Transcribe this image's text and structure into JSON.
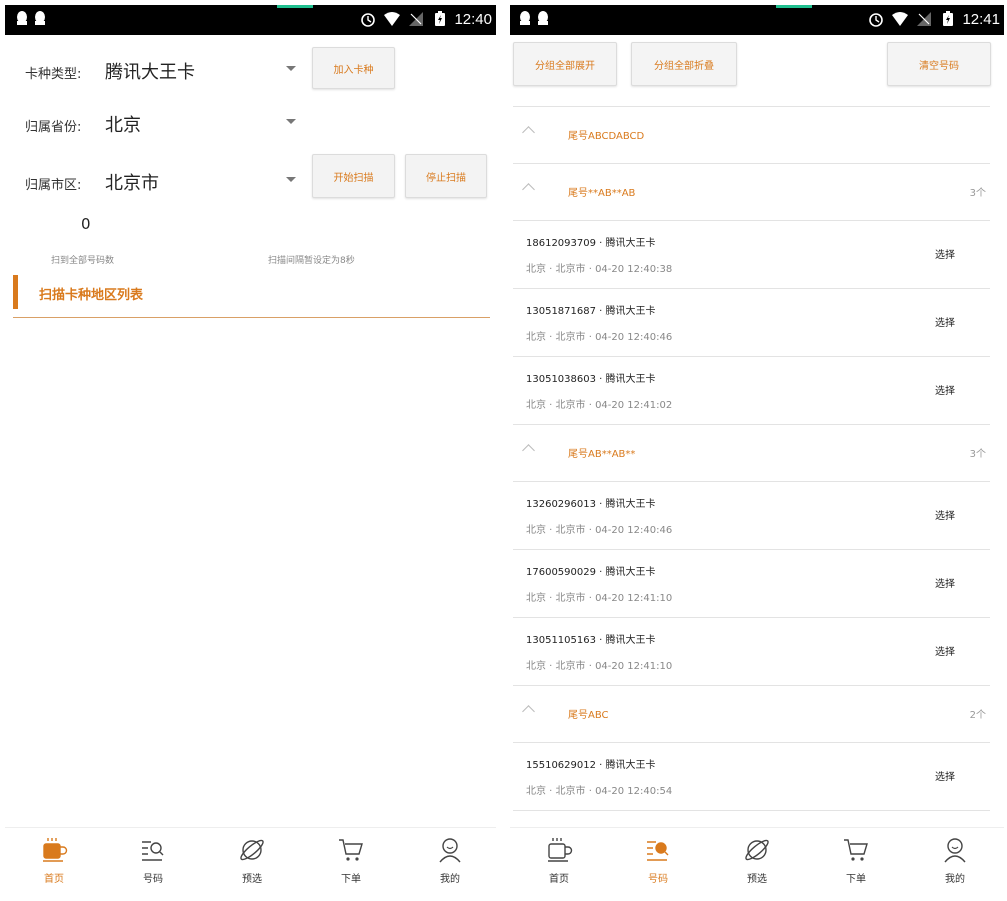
{
  "colors": {
    "accent": "#d97a1d",
    "statusbar": "#000000",
    "notif": "#1fbf8f"
  },
  "left": {
    "status": {
      "time": "12:40"
    },
    "form": {
      "card_type_label": "卡种类型:",
      "card_type_value": "腾讯大王卡",
      "add_card_button": "加入卡种",
      "province_label": "归属省份:",
      "province_value": "北京",
      "city_label": "归属市区:",
      "city_value": "北京市",
      "start_scan_button": "开始扫描",
      "stop_scan_button": "停止扫描"
    },
    "stats": {
      "count": "0",
      "count_label": "扫到全部号码数",
      "interval_text": "扫描间隔暂设定为8秒"
    },
    "section_title": "扫描卡种地区列表"
  },
  "right": {
    "status": {
      "time": "12:41"
    },
    "buttons": {
      "expand_all": "分组全部展开",
      "collapse_all": "分组全部折叠",
      "clear": "清空号码"
    },
    "groups": [
      {
        "title": "尾号ABCDABCD",
        "count": "",
        "items": []
      },
      {
        "title": "尾号**AB**AB",
        "count": "3个",
        "items": [
          {
            "number": "18612093709 · 腾讯大王卡",
            "meta": "北京 · 北京市 · 04-20 12:40:38",
            "select": "选择"
          },
          {
            "number": "13051871687 · 腾讯大王卡",
            "meta": "北京 · 北京市 · 04-20 12:40:46",
            "select": "选择"
          },
          {
            "number": "13051038603 · 腾讯大王卡",
            "meta": "北京 · 北京市 · 04-20 12:41:02",
            "select": "选择"
          }
        ]
      },
      {
        "title": "尾号AB**AB**",
        "count": "3个",
        "items": [
          {
            "number": "13260296013 · 腾讯大王卡",
            "meta": "北京 · 北京市 · 04-20 12:40:46",
            "select": "选择"
          },
          {
            "number": "17600590029 · 腾讯大王卡",
            "meta": "北京 · 北京市 · 04-20 12:41:10",
            "select": "选择"
          },
          {
            "number": "13051105163 · 腾讯大王卡",
            "meta": "北京 · 北京市 · 04-20 12:41:10",
            "select": "选择"
          }
        ]
      },
      {
        "title": "尾号ABC",
        "count": "2个",
        "items": [
          {
            "number": "15510629012 · 腾讯大王卡",
            "meta": "北京 · 北京市 · 04-20 12:40:54",
            "select": "选择"
          }
        ]
      }
    ]
  },
  "nav": [
    {
      "label": "首页",
      "icon": "coffee-cup-icon"
    },
    {
      "label": "号码",
      "icon": "list-search-icon"
    },
    {
      "label": "预选",
      "icon": "planet-icon"
    },
    {
      "label": "下单",
      "icon": "cart-icon"
    },
    {
      "label": "我的",
      "icon": "user-icon"
    }
  ],
  "nav_active": {
    "left": 0,
    "right": 1
  }
}
